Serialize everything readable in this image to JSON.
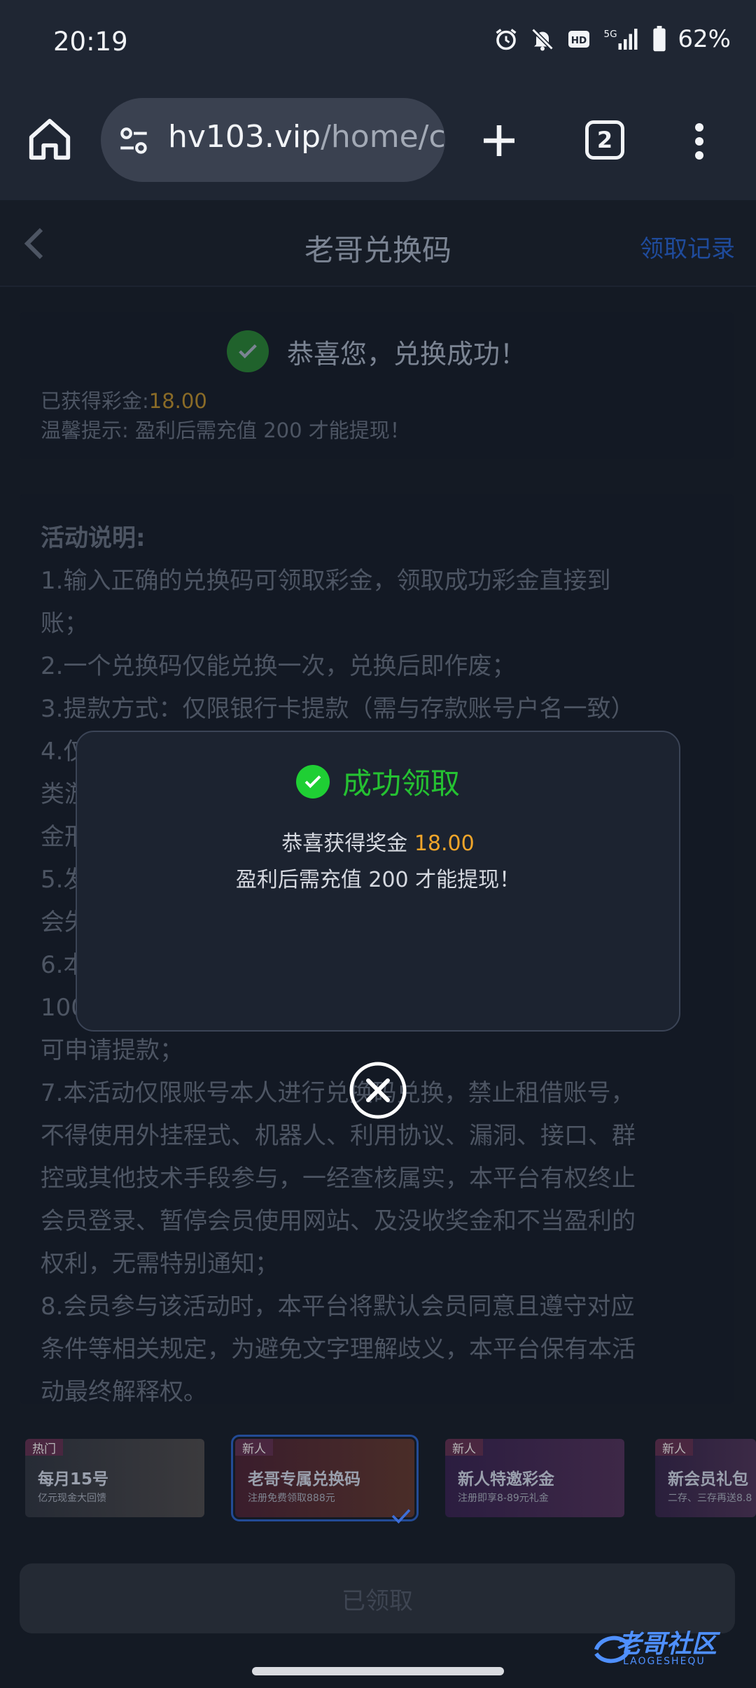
{
  "status_bar": {
    "time": "20:19",
    "battery": "62%",
    "network": "5G",
    "icons": [
      "alarm-icon",
      "bell-off-icon",
      "hd-icon",
      "signal-icon",
      "battery-icon"
    ]
  },
  "browser": {
    "url_host": "hv103.vip",
    "url_path": "/home/c",
    "tab_count": "2"
  },
  "page": {
    "title": "老哥兑换码",
    "records_link": "领取记录",
    "success_card": {
      "message": "恭喜您，兑换成功！",
      "gained_label": "已获得彩金:",
      "gained_amount": "18.00",
      "tip_text": "温馨提示: 盈利后需充值 200 才能提现！"
    },
    "activity": {
      "heading": "活动说明:",
      "lines": [
        "1.输入正确的兑换码可领取彩金，领取成功彩金直接到",
        "账；",
        "2.一个兑换码仅能兑换一次，兑换后即作废；",
        "3.提款方式：仅限银行卡提款（需与存款账号户名一致）",
        "4.仅",
        "类游",
        "金形",
        "5.发",
        "会失",
        "6.本",
        "100",
        "可申请提款；",
        "7.本活动仅限账号本人进行兑换码兑换，禁止租借账号，",
        "不得使用外挂程式、机器人、利用协议、漏洞、接口、群",
        "控或其他技术手段参与，一经查核属实，本平台有权终止",
        "会员登录、暂停会员使用网站、及没收奖金和不当盈利的",
        "权利，无需特别通知；",
        "8.会员参与该活动时，本平台将默认会员同意且遵守对应",
        "条件等相关规定，为避免文字理解歧义，本平台保有本活",
        "动最终解释权。"
      ]
    },
    "banners": [
      {
        "tag": "热门",
        "title": "每月15号",
        "subtitle": "亿元现金大回馈"
      },
      {
        "tag": "新人",
        "title": "老哥专属兑换码",
        "subtitle": "注册免费领取888元"
      },
      {
        "tag": "新人",
        "title": "新人特邀彩金",
        "subtitle": "注册即享8-89元礼金"
      },
      {
        "tag": "新人",
        "title": "新会员礼包",
        "subtitle": "二存、三存再送8.8"
      }
    ],
    "claimed_button": "已领取",
    "watermark": {
      "main": "老哥社区",
      "sub": "LAOGESHEQU"
    }
  },
  "modal": {
    "title": "成功领取",
    "line1_prefix": "恭喜获得奖金",
    "line1_amount": "18.00",
    "line2": "盈利后需充值 200 才能提现！"
  },
  "colors": {
    "success_green": "#25c132",
    "amount_orange": "#f0a52a",
    "link_blue": "#1f4b9c"
  }
}
